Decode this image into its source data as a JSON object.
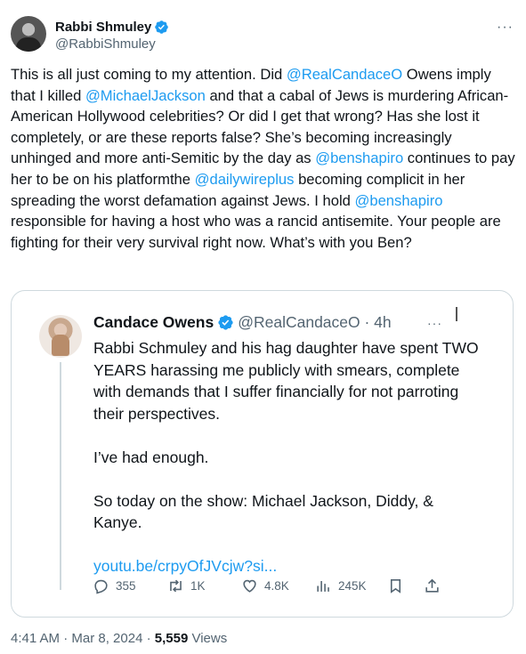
{
  "author": {
    "name": "Rabbi Shmuley",
    "handle": "@RabbiShmuley"
  },
  "tweet": {
    "segments": [
      {
        "text": "This is all just coming to my attention. Did ",
        "type": "text"
      },
      {
        "text": "@RealCandaceO",
        "type": "mention"
      },
      {
        "text": " Owens imply that I killed ",
        "type": "text"
      },
      {
        "text": "@MichaelJackson",
        "type": "mention"
      },
      {
        "text": " and that a cabal of Jews is murdering African-American Hollywood celebrities? Or did I get that wrong? Has she lost it completely, or are these reports false? She’s becoming increasingly unhinged and more anti-Semitic by the day as ",
        "type": "text"
      },
      {
        "text": "@benshapiro",
        "type": "mention"
      },
      {
        "text": " continues to pay her to be on his platformthe ",
        "type": "text"
      },
      {
        "text": "@dailywireplus",
        "type": "mention"
      },
      {
        "text": " becoming complicit in her spreading the worst defamation against Jews. I hold ",
        "type": "text"
      },
      {
        "text": "@benshapiro",
        "type": "mention"
      },
      {
        "text": " responsible for having a host who was a rancid antisemite. Your people are fighting for their very survival right now. What’s with you Ben?",
        "type": "text"
      }
    ]
  },
  "quote": {
    "name": "Candace Owens",
    "handle_time": "@RealCandaceO · 4h",
    "more": "···",
    "text": "Rabbi Schmuley and his hag daughter have spent TWO YEARS harassing me publicly with smears, complete with demands that I suffer financially for not parroting their perspectives.\n\nI’ve had enough.\n\nSo today on the show: Michael Jackson, Diddy, & Kanye.\n\n",
    "link": "youtu.be/crpyOfJVcjw?si...",
    "stats": {
      "replies": "355",
      "retweets": "1K",
      "likes": "4.8K",
      "views": "245K"
    }
  },
  "meta": {
    "time_date": "4:41 AM · Mar 8, 2024 · ",
    "views_count": "5,559",
    "views_label": " Views"
  },
  "colors": {
    "accent": "#1d9bf0",
    "text": "#0f1419",
    "secondary": "#536471",
    "border": "#cfd9de"
  }
}
